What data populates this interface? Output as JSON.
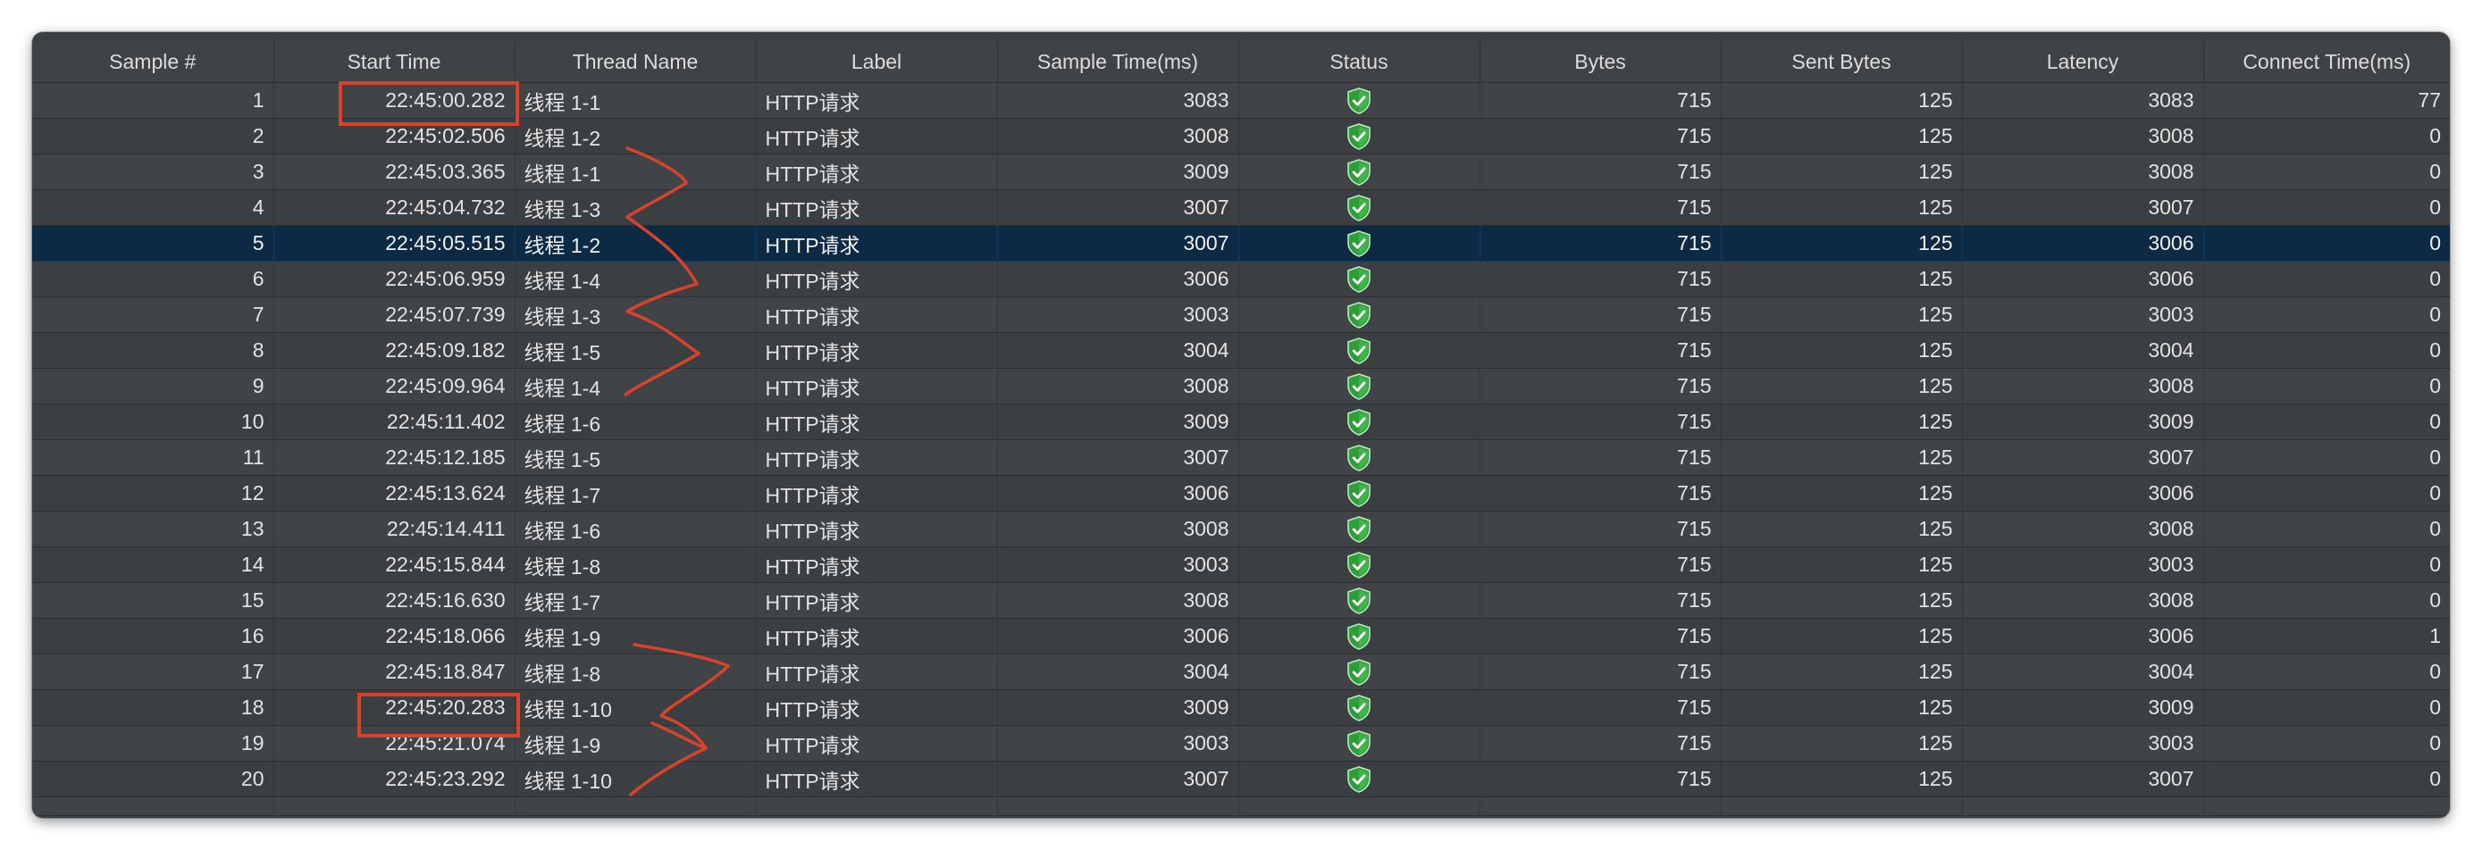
{
  "columns": [
    "Sample #",
    "Start Time",
    "Thread Name",
    "Label",
    "Sample Time(ms)",
    "Status",
    "Bytes",
    "Sent Bytes",
    "Latency",
    "Connect Time(ms)"
  ],
  "status_icon": "green-shield-check-icon",
  "selected_sample": "5",
  "rows": [
    {
      "sample": "1",
      "start_time": "22:45:00.282",
      "thread": "线程 1-1",
      "label": "HTTP请求",
      "sample_time": "3083",
      "bytes": "715",
      "sent_bytes": "125",
      "latency": "3083",
      "connect_time": "77"
    },
    {
      "sample": "2",
      "start_time": "22:45:02.506",
      "thread": "线程 1-2",
      "label": "HTTP请求",
      "sample_time": "3008",
      "bytes": "715",
      "sent_bytes": "125",
      "latency": "3008",
      "connect_time": "0"
    },
    {
      "sample": "3",
      "start_time": "22:45:03.365",
      "thread": "线程 1-1",
      "label": "HTTP请求",
      "sample_time": "3009",
      "bytes": "715",
      "sent_bytes": "125",
      "latency": "3008",
      "connect_time": "0"
    },
    {
      "sample": "4",
      "start_time": "22:45:04.732",
      "thread": "线程 1-3",
      "label": "HTTP请求",
      "sample_time": "3007",
      "bytes": "715",
      "sent_bytes": "125",
      "latency": "3007",
      "connect_time": "0"
    },
    {
      "sample": "5",
      "start_time": "22:45:05.515",
      "thread": "线程 1-2",
      "label": "HTTP请求",
      "sample_time": "3007",
      "bytes": "715",
      "sent_bytes": "125",
      "latency": "3006",
      "connect_time": "0"
    },
    {
      "sample": "6",
      "start_time": "22:45:06.959",
      "thread": "线程 1-4",
      "label": "HTTP请求",
      "sample_time": "3006",
      "bytes": "715",
      "sent_bytes": "125",
      "latency": "3006",
      "connect_time": "0"
    },
    {
      "sample": "7",
      "start_time": "22:45:07.739",
      "thread": "线程 1-3",
      "label": "HTTP请求",
      "sample_time": "3003",
      "bytes": "715",
      "sent_bytes": "125",
      "latency": "3003",
      "connect_time": "0"
    },
    {
      "sample": "8",
      "start_time": "22:45:09.182",
      "thread": "线程 1-5",
      "label": "HTTP请求",
      "sample_time": "3004",
      "bytes": "715",
      "sent_bytes": "125",
      "latency": "3004",
      "connect_time": "0"
    },
    {
      "sample": "9",
      "start_time": "22:45:09.964",
      "thread": "线程 1-4",
      "label": "HTTP请求",
      "sample_time": "3008",
      "bytes": "715",
      "sent_bytes": "125",
      "latency": "3008",
      "connect_time": "0"
    },
    {
      "sample": "10",
      "start_time": "22:45:11.402",
      "thread": "线程 1-6",
      "label": "HTTP请求",
      "sample_time": "3009",
      "bytes": "715",
      "sent_bytes": "125",
      "latency": "3009",
      "connect_time": "0"
    },
    {
      "sample": "11",
      "start_time": "22:45:12.185",
      "thread": "线程 1-5",
      "label": "HTTP请求",
      "sample_time": "3007",
      "bytes": "715",
      "sent_bytes": "125",
      "latency": "3007",
      "connect_time": "0"
    },
    {
      "sample": "12",
      "start_time": "22:45:13.624",
      "thread": "线程 1-7",
      "label": "HTTP请求",
      "sample_time": "3006",
      "bytes": "715",
      "sent_bytes": "125",
      "latency": "3006",
      "connect_time": "0"
    },
    {
      "sample": "13",
      "start_time": "22:45:14.411",
      "thread": "线程 1-6",
      "label": "HTTP请求",
      "sample_time": "3008",
      "bytes": "715",
      "sent_bytes": "125",
      "latency": "3008",
      "connect_time": "0"
    },
    {
      "sample": "14",
      "start_time": "22:45:15.844",
      "thread": "线程 1-8",
      "label": "HTTP请求",
      "sample_time": "3003",
      "bytes": "715",
      "sent_bytes": "125",
      "latency": "3003",
      "connect_time": "0"
    },
    {
      "sample": "15",
      "start_time": "22:45:16.630",
      "thread": "线程 1-7",
      "label": "HTTP请求",
      "sample_time": "3008",
      "bytes": "715",
      "sent_bytes": "125",
      "latency": "3008",
      "connect_time": "0"
    },
    {
      "sample": "16",
      "start_time": "22:45:18.066",
      "thread": "线程 1-9",
      "label": "HTTP请求",
      "sample_time": "3006",
      "bytes": "715",
      "sent_bytes": "125",
      "latency": "3006",
      "connect_time": "1"
    },
    {
      "sample": "17",
      "start_time": "22:45:18.847",
      "thread": "线程 1-8",
      "label": "HTTP请求",
      "sample_time": "3004",
      "bytes": "715",
      "sent_bytes": "125",
      "latency": "3004",
      "connect_time": "0"
    },
    {
      "sample": "18",
      "start_time": "22:45:20.283",
      "thread": "线程 1-10",
      "label": "HTTP请求",
      "sample_time": "3009",
      "bytes": "715",
      "sent_bytes": "125",
      "latency": "3009",
      "connect_time": "0"
    },
    {
      "sample": "19",
      "start_time": "22:45:21.074",
      "thread": "线程 1-9",
      "label": "HTTP请求",
      "sample_time": "3003",
      "bytes": "715",
      "sent_bytes": "125",
      "latency": "3003",
      "connect_time": "0"
    },
    {
      "sample": "20",
      "start_time": "22:45:23.292",
      "thread": "线程 1-10",
      "label": "HTTP请求",
      "sample_time": "3007",
      "bytes": "715",
      "sent_bytes": "125",
      "latency": "3007",
      "connect_time": "0"
    }
  ],
  "annotation_color": "#d8432c",
  "annotation_boxed_samples": [
    "1",
    "18"
  ]
}
